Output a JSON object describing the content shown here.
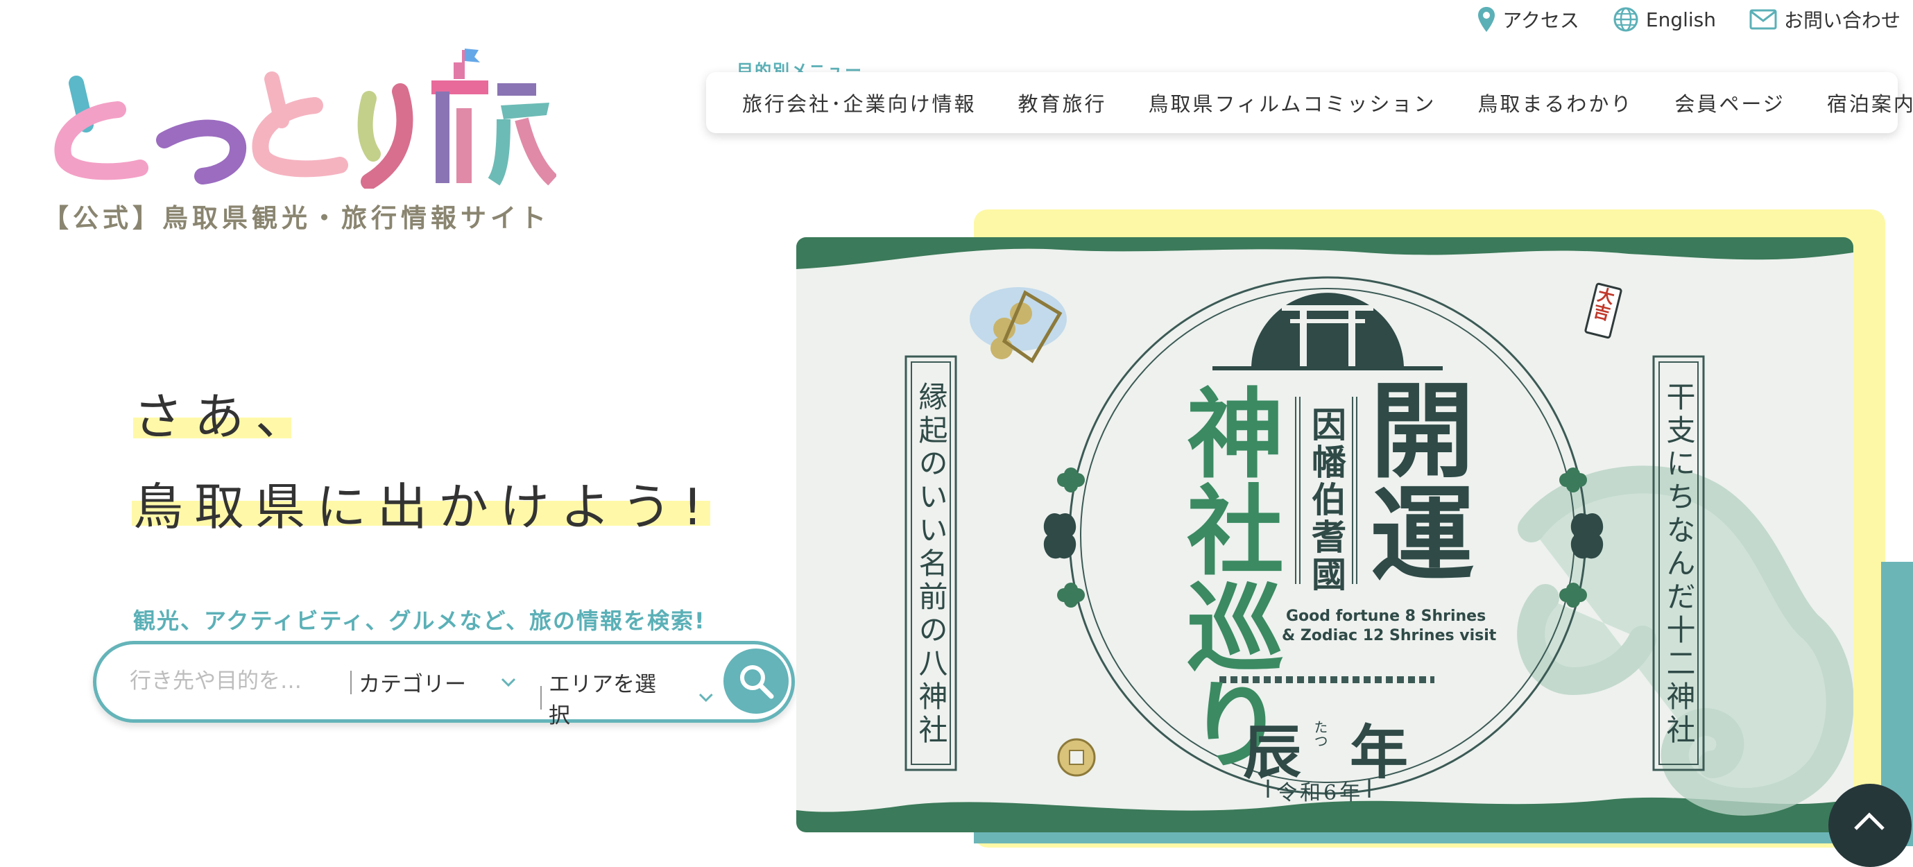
{
  "utility": {
    "access_label": "アクセス",
    "english_label": "English",
    "contact_label": "お問い合わせ"
  },
  "logo": {
    "text": "とっとり旅",
    "subtitle": "【公式】鳥取県観光・旅行情報サイト"
  },
  "nav": {
    "label": "目的別メニュー",
    "items": [
      {
        "label": "旅行会社･企業向け情報"
      },
      {
        "label": "教育旅行"
      },
      {
        "label": "鳥取県フィルムコミッション"
      },
      {
        "label": "鳥取まるわかり"
      },
      {
        "label": "会員ページ"
      },
      {
        "label": "宿泊案内"
      }
    ]
  },
  "hero": {
    "line1": "さあ、",
    "line2": "鳥取県に出かけよう!"
  },
  "search": {
    "hint": "観光、アクティビティ、グルメなど、旅の情報を検索!",
    "placeholder": "行き先や目的を…",
    "category_label": "カテゴリー",
    "area_label": "エリアを選択"
  },
  "banner": {
    "left_vertical": "縁起のいい名前の八神社",
    "right_vertical": "干支にちなんだ十二神社",
    "title_left": "神社巡り",
    "title_center": "因幡伯耆國",
    "title_right": "開運",
    "english_line1": "Good fortune 8 Shrines",
    "english_line2": "& Zodiac 12 Shrines visit",
    "year": "辰年",
    "year_ruby": "たつ",
    "era": "令和6年",
    "charm": "大吉"
  },
  "colors": {
    "accent_teal": "#64b4b9",
    "banner_green": "#3c7a5a",
    "highlight_yellow": "#fff8a8"
  }
}
